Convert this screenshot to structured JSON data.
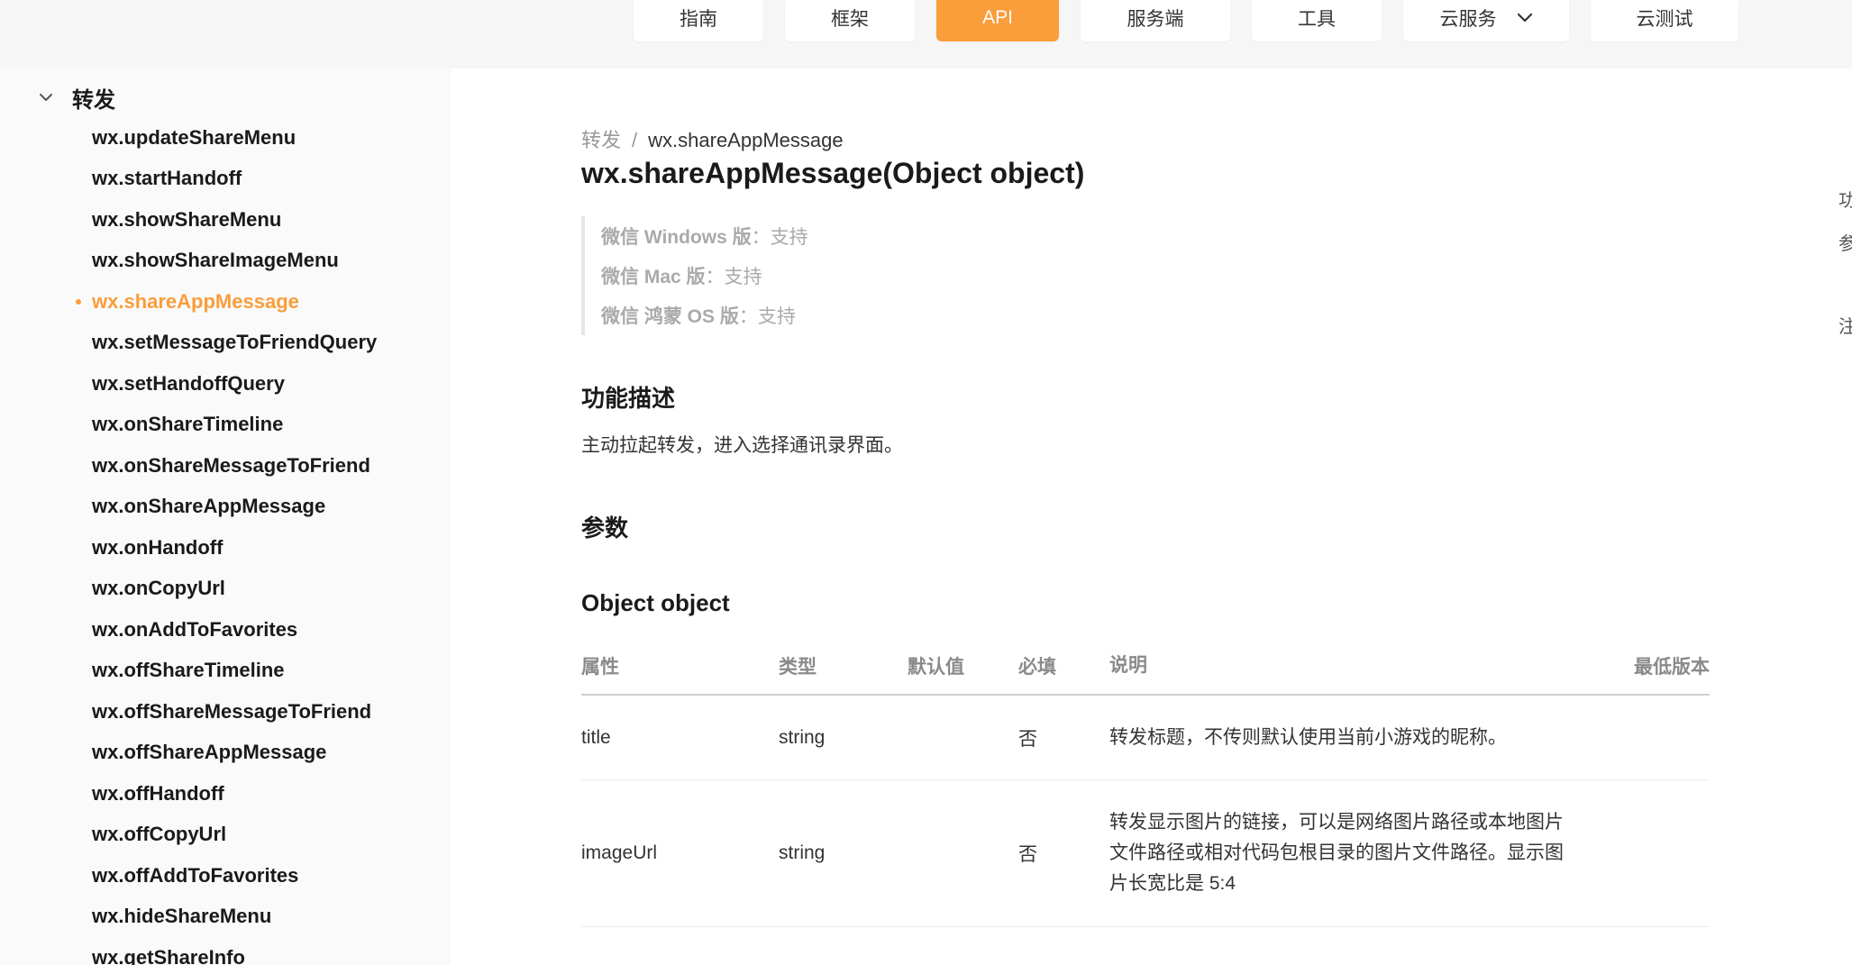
{
  "nav": {
    "items": [
      "指南",
      "框架",
      "API",
      "服务端",
      "工具",
      "云服务",
      "云测试"
    ],
    "active": "API",
    "dropdown_item": "云服务"
  },
  "sidebar": {
    "group_title": "转发",
    "items": [
      "wx.updateShareMenu",
      "wx.startHandoff",
      "wx.showShareMenu",
      "wx.showShareImageMenu",
      "wx.shareAppMessage",
      "wx.setMessageToFriendQuery",
      "wx.setHandoffQuery",
      "wx.onShareTimeline",
      "wx.onShareMessageToFriend",
      "wx.onShareAppMessage",
      "wx.onHandoff",
      "wx.onCopyUrl",
      "wx.onAddToFavorites",
      "wx.offShareTimeline",
      "wx.offShareMessageToFriend",
      "wx.offShareAppMessage",
      "wx.offHandoff",
      "wx.offCopyUrl",
      "wx.offAddToFavorites",
      "wx.hideShareMenu",
      "wx.getShareInfo"
    ],
    "active_item": "wx.shareAppMessage"
  },
  "breadcrumb": {
    "parent": "转发",
    "separator": "/",
    "current": "wx.shareAppMessage"
  },
  "page_title": "wx.shareAppMessage(Object object)",
  "support": [
    {
      "platform": "微信 Windows 版",
      "status": "：支持"
    },
    {
      "platform": "微信 Mac 版",
      "status": "：支持"
    },
    {
      "platform": "微信 鸿蒙 OS 版",
      "status": "：支持"
    }
  ],
  "sections": {
    "func_title": "功能描述",
    "func_desc": "主动拉起转发，进入选择通讯录界面。",
    "params_title": "参数",
    "object_title": "Object object"
  },
  "table": {
    "headers": {
      "name": "属性",
      "type": "类型",
      "default": "默认值",
      "required": "必填",
      "desc": "说明",
      "version": "最低版本"
    },
    "rows": [
      {
        "name": "title",
        "type": "string",
        "default": "",
        "required": "否",
        "desc": "转发标题，不传则默认使用当前小游戏的昵称。",
        "version": ""
      },
      {
        "name": "imageUrl",
        "type": "string",
        "default": "",
        "required": "否",
        "desc": "转发显示图片的链接，可以是网络图片路径或本地图片文件路径或相对代码包根目录的图片文件路径。显示图片长宽比是 5:4",
        "version": ""
      }
    ]
  },
  "right_toc_fragments": [
    "功",
    "参",
    "注"
  ],
  "colors": {
    "accent": "#fa9d3b",
    "topbar_bg": "#f6f6f6",
    "sidebar_bg": "#fafafa"
  }
}
